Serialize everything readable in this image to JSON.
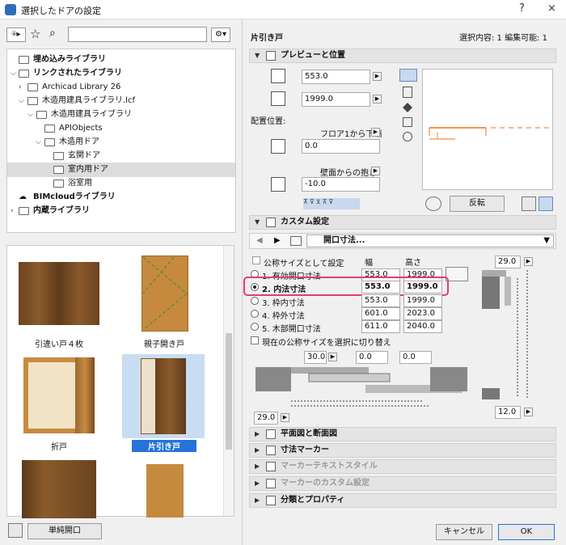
{
  "window": {
    "title": "選択したドアの設定",
    "help": "?",
    "close": "×"
  },
  "search": {
    "placeholder": ""
  },
  "tree": [
    {
      "label": "埋め込みライブラリ",
      "bold": true
    },
    {
      "label": "リンクされたライブラリ",
      "bold": true
    },
    {
      "label": "Archicad Library 26",
      "bold": false
    },
    {
      "label": "木造用建具ライブラリ.lcf",
      "bold": false
    },
    {
      "label": "木造用建具ライブラリ",
      "bold": false
    },
    {
      "label": "APIObjects",
      "bold": false
    },
    {
      "label": "木造用ドア",
      "bold": false
    },
    {
      "label": "玄関ドア",
      "bold": false
    },
    {
      "label": "室内用ドア",
      "bold": false
    },
    {
      "label": "浴室用",
      "bold": false
    },
    {
      "label": "BIMcloudライブラリ",
      "bold": true
    },
    {
      "label": "内蔵ライブラリ",
      "bold": true
    }
  ],
  "thumbnails": [
    {
      "caption": "引違い戸４枚"
    },
    {
      "caption": "親子開き戸"
    },
    {
      "caption": "折戸"
    },
    {
      "caption": "片引き戸"
    },
    {
      "caption": ""
    },
    {
      "caption": ""
    }
  ],
  "left_footer": {
    "opening_button": "単純開口"
  },
  "header": {
    "object_name": "片引き戸",
    "selection_info": "選択内容: 1 編集可能: 1"
  },
  "preview": {
    "section_title": "プレビューと位置",
    "width_value": "553.0",
    "height_value": "1999.0",
    "placement_label": "配置位置:",
    "floor_ref": "フロア1から下端",
    "floor_value": "0.0",
    "wall_ref": "壁面からの抱き",
    "wall_value": "-10.0",
    "flip_button": "反転"
  },
  "custom": {
    "section_title": "カスタム設定",
    "page_title": "開口寸法...",
    "nominal_label": "公称サイズとして設定",
    "col_width": "幅",
    "col_height": "高さ",
    "rows": [
      {
        "label": "1. 有効開口寸法",
        "width": "553.0",
        "height": "1999.0",
        "selected": false
      },
      {
        "label": "2. 内法寸法",
        "width": "553.0",
        "height": "1999.0",
        "selected": true
      },
      {
        "label": "3. 枠内寸法",
        "width": "553.0",
        "height": "1999.0",
        "selected": false
      },
      {
        "label": "4. 枠外寸法",
        "width": "601.0",
        "height": "2023.0",
        "selected": false
      },
      {
        "label": "5. 木部開口寸法",
        "width": "611.0",
        "height": "2040.0",
        "selected": false
      }
    ],
    "switch_label": "現在の公称サイズを選択に切り替え",
    "dim_top_right": "29.0",
    "dim_bottom_right": "12.0",
    "dim_a": "30.0",
    "dim_b": "0.0",
    "dim_c": "0.0",
    "dim_bottom_left": "29.0"
  },
  "sections": [
    {
      "label": "平面図と断面図",
      "dim": false
    },
    {
      "label": "寸法マーカー",
      "dim": false
    },
    {
      "label": "マーカーテキストスタイル",
      "dim": true
    },
    {
      "label": "マーカーのカスタム設定",
      "dim": true
    },
    {
      "label": "分類とプロパティ",
      "dim": false
    }
  ],
  "footer": {
    "cancel": "キャンセル",
    "ok": "OK"
  }
}
